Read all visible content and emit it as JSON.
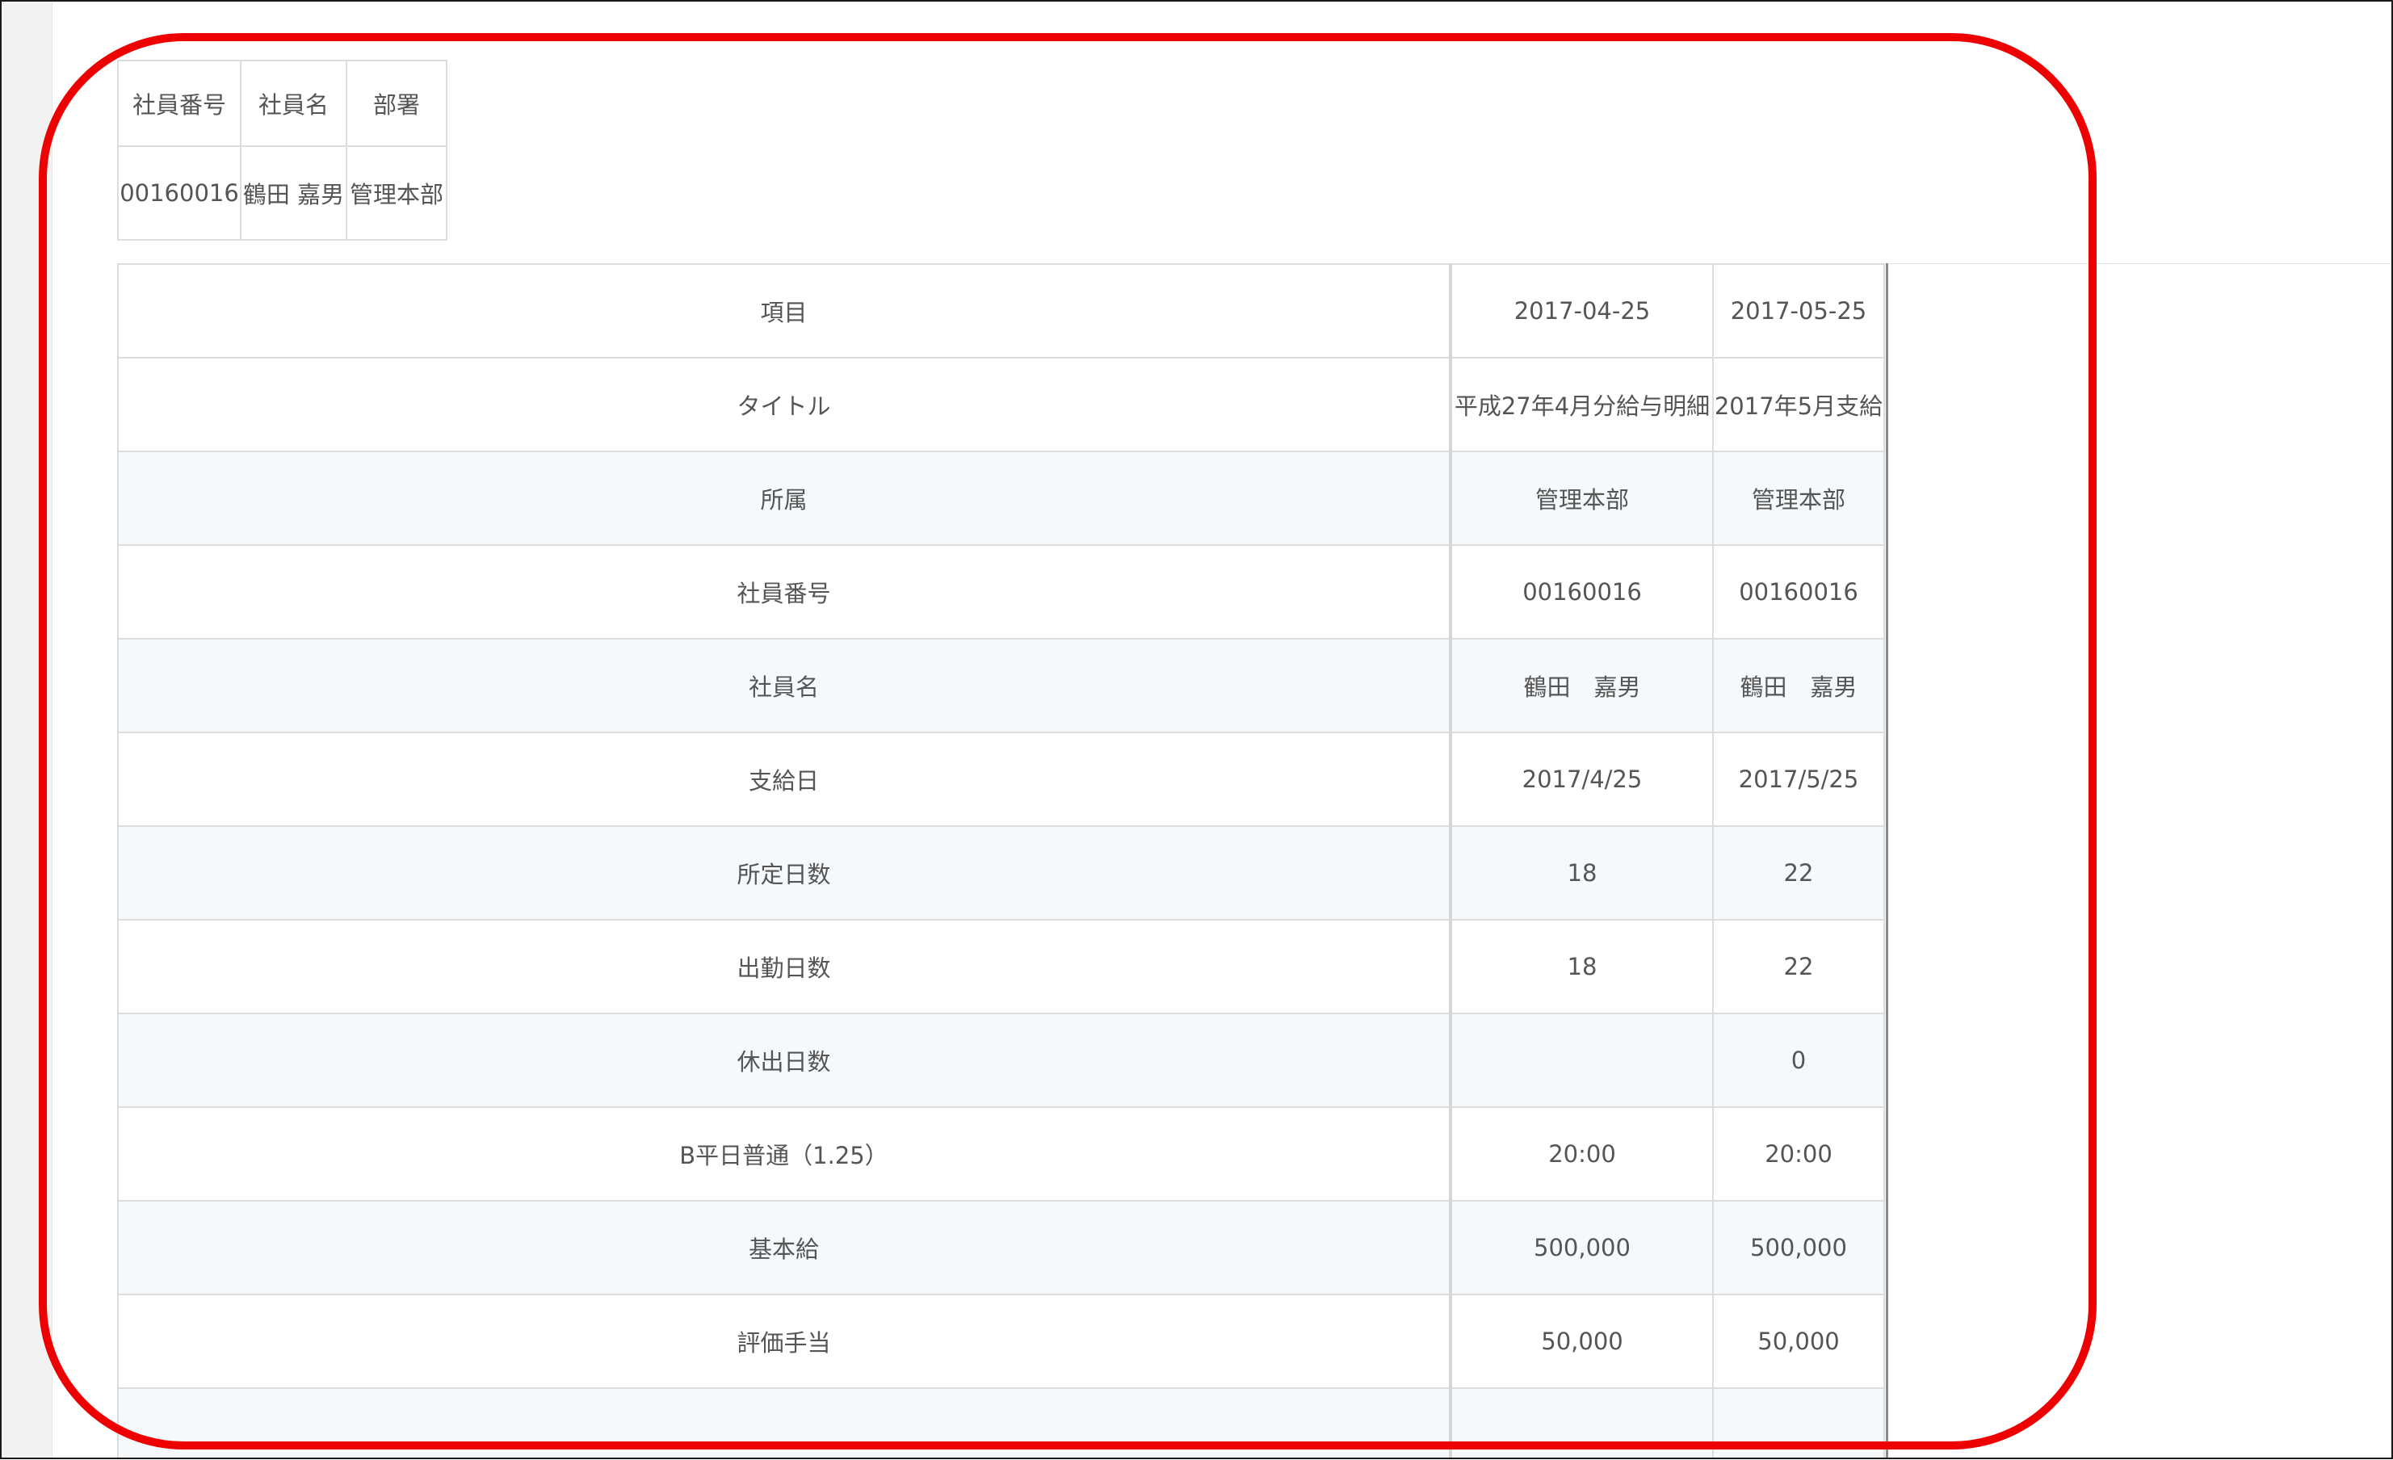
{
  "employee_summary": {
    "headers": [
      "社員番号",
      "社員名",
      "部署"
    ],
    "values": [
      "00160016",
      "鶴田 嘉男",
      "管理本部"
    ]
  },
  "payslip_table": {
    "header": {
      "label": "項目",
      "periods": [
        "2017-04-25",
        "2017-05-25"
      ]
    },
    "rows": [
      {
        "label": "タイトル",
        "values": [
          "平成27年4月分給与明細",
          "2017年5月支給"
        ]
      },
      {
        "label": "所属",
        "values": [
          "管理本部",
          "管理本部"
        ]
      },
      {
        "label": "社員番号",
        "values": [
          "00160016",
          "00160016"
        ]
      },
      {
        "label": "社員名",
        "values": [
          "鶴田　嘉男",
          "鶴田　嘉男"
        ]
      },
      {
        "label": "支給日",
        "values": [
          "2017/4/25",
          "2017/5/25"
        ]
      },
      {
        "label": "所定日数",
        "values": [
          "18",
          "22"
        ]
      },
      {
        "label": "出勤日数",
        "values": [
          "18",
          "22"
        ]
      },
      {
        "label": "休出日数",
        "values": [
          "",
          "0"
        ]
      },
      {
        "label": "B平日普通（1.25）",
        "values": [
          "20:00",
          "20:00"
        ]
      },
      {
        "label": "基本給",
        "values": [
          "500,000",
          "500,000"
        ]
      },
      {
        "label": "評価手当",
        "values": [
          "50,000",
          "50,000"
        ]
      }
    ]
  },
  "highlight_color": "#ee0000"
}
